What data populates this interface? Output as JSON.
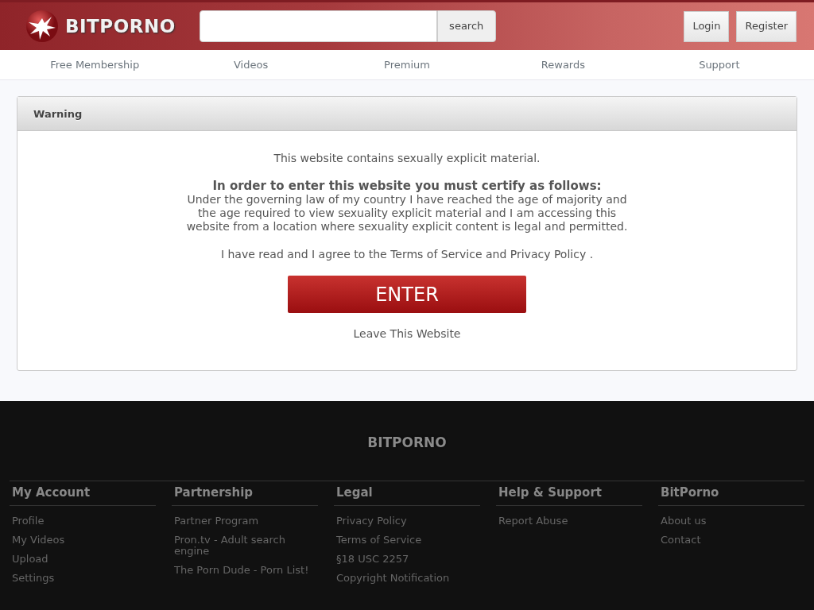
{
  "header": {
    "logo_text": "BITPORNO",
    "search": {
      "button": "search"
    },
    "buttons": [
      "Login",
      "Register"
    ]
  },
  "nav": [
    "Free Membership",
    "Videos",
    "Premium",
    "Rewards",
    "Support"
  ],
  "warning": {
    "title": "Warning",
    "intro": "This website contains sexually explicit material.",
    "certify_heading": "In order to enter this website you must certify as follows:",
    "certify_text": "Under the governing law of my country I have reached the age of majority and the age required to view sexuality explicit material and I am accessing this website from a location where sexuality explicit content is legal and permitted.",
    "agree": {
      "before": "I have read and I agree to the ",
      "terms_link": "Terms of Service",
      "middle": " and ",
      "privacy_link": "Privacy Policy",
      "after": " ."
    },
    "enter_button": "ENTER",
    "leave_link": "Leave This Website"
  },
  "footer": {
    "logo_text": "BITPORNO",
    "columns": [
      {
        "heading": "My Account",
        "links": [
          "Profile",
          "My Videos",
          "Upload",
          "Settings"
        ]
      },
      {
        "heading": "Partnership",
        "links": [
          "Partner Program",
          "Pron.tv - Adult search engine",
          "The Porn Dude - Porn List!"
        ]
      },
      {
        "heading": "Legal",
        "links": [
          "Privacy Policy",
          "Terms of Service",
          "§18 USC 2257",
          "Copyright Notification"
        ]
      },
      {
        "heading": "Help & Support",
        "links": [
          "Report Abuse"
        ]
      },
      {
        "heading": "BitPorno",
        "links": [
          "About us",
          "Contact"
        ]
      }
    ]
  }
}
